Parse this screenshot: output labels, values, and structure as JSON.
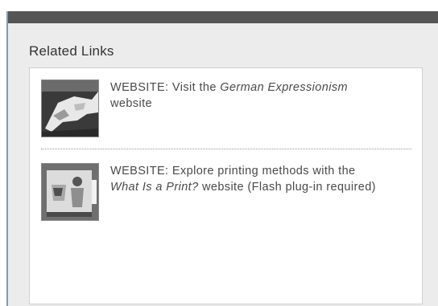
{
  "panel": {
    "title": "Related Links"
  },
  "links": [
    {
      "thumbnail_icon": "expressionist-artwork-thumbnail",
      "prefix": "WEBSITE: Visit the ",
      "italic": "German Expressionism",
      "suffix": " website"
    },
    {
      "thumbnail_icon": "print-artwork-thumbnail",
      "prefix": "WEBSITE: Explore printing methods with the ",
      "italic": "What Is a Print?",
      "suffix": " website (Flash plug-in required)"
    }
  ],
  "colors": {
    "topbar": "#555555",
    "panel_background": "#ececec",
    "text": "#4a4a4a"
  }
}
